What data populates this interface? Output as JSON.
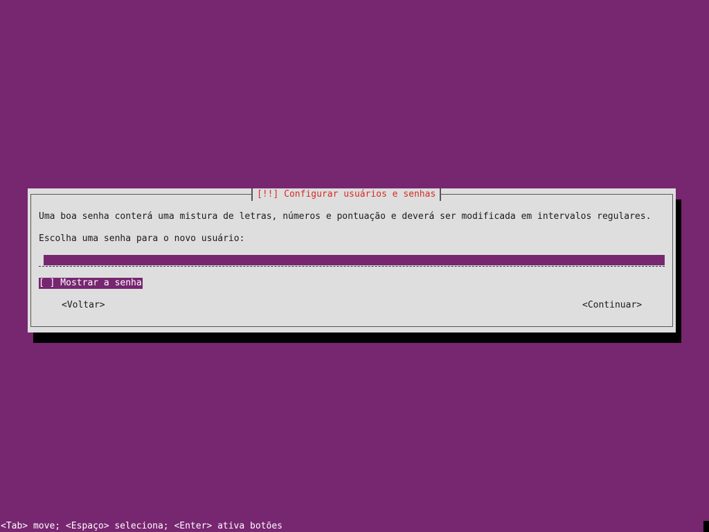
{
  "dialog": {
    "title": "[!!] Configurar usuários e senhas",
    "description": "Uma boa senha conterá uma mistura de letras, números e pontuação e deverá ser modificada em intervalos regulares.",
    "prompt": "Escolha uma senha para o novo usuário:",
    "password_value": "",
    "checkbox_label": "[ ] Mostrar a senha",
    "back_button": "<Voltar>",
    "continue_button": "<Continuar>"
  },
  "footer": {
    "hint": "<Tab> move; <Espaço> seleciona; <Enter> ativa botões"
  },
  "colors": {
    "background": "#772670",
    "dialog": "#dedede",
    "title": "#d22d26",
    "shadow": "#000000"
  }
}
